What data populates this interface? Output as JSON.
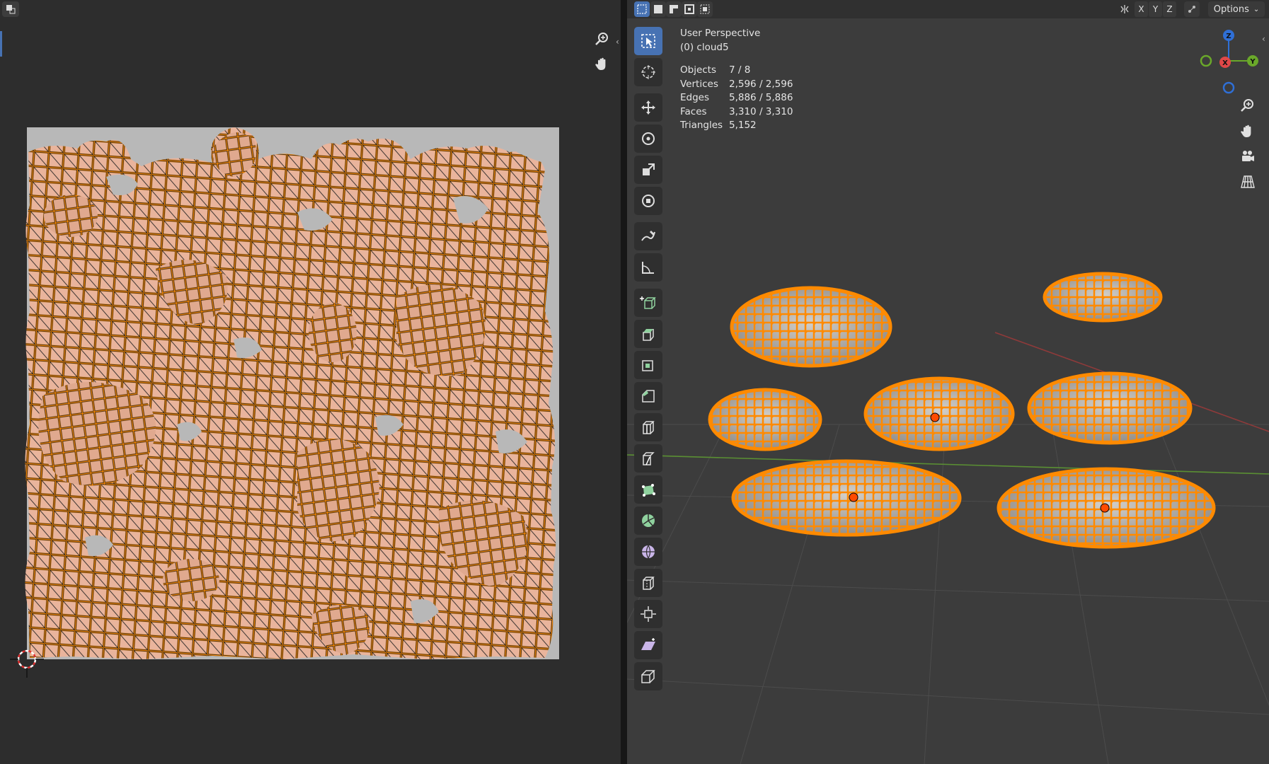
{
  "viewport": {
    "view_name": "User Perspective",
    "active_object": "(0) cloud5",
    "stats": [
      {
        "label": "Objects",
        "value": "7 / 8"
      },
      {
        "label": "Vertices",
        "value": "2,596 / 2,596"
      },
      {
        "label": "Edges",
        "value": "5,886 / 5,886"
      },
      {
        "label": "Faces",
        "value": "3,310 / 3,310"
      },
      {
        "label": "Triangles",
        "value": "5,152"
      }
    ],
    "axis_x": "X",
    "axis_y": "Y",
    "axis_z": "Z",
    "options_label": "Options",
    "gizmo": {
      "x": "X",
      "y": "Y",
      "z": "Z"
    }
  },
  "colors": {
    "selection": "#ff8a00",
    "uv_background": "#b8b8b8",
    "active_tool": "#4772b3"
  }
}
